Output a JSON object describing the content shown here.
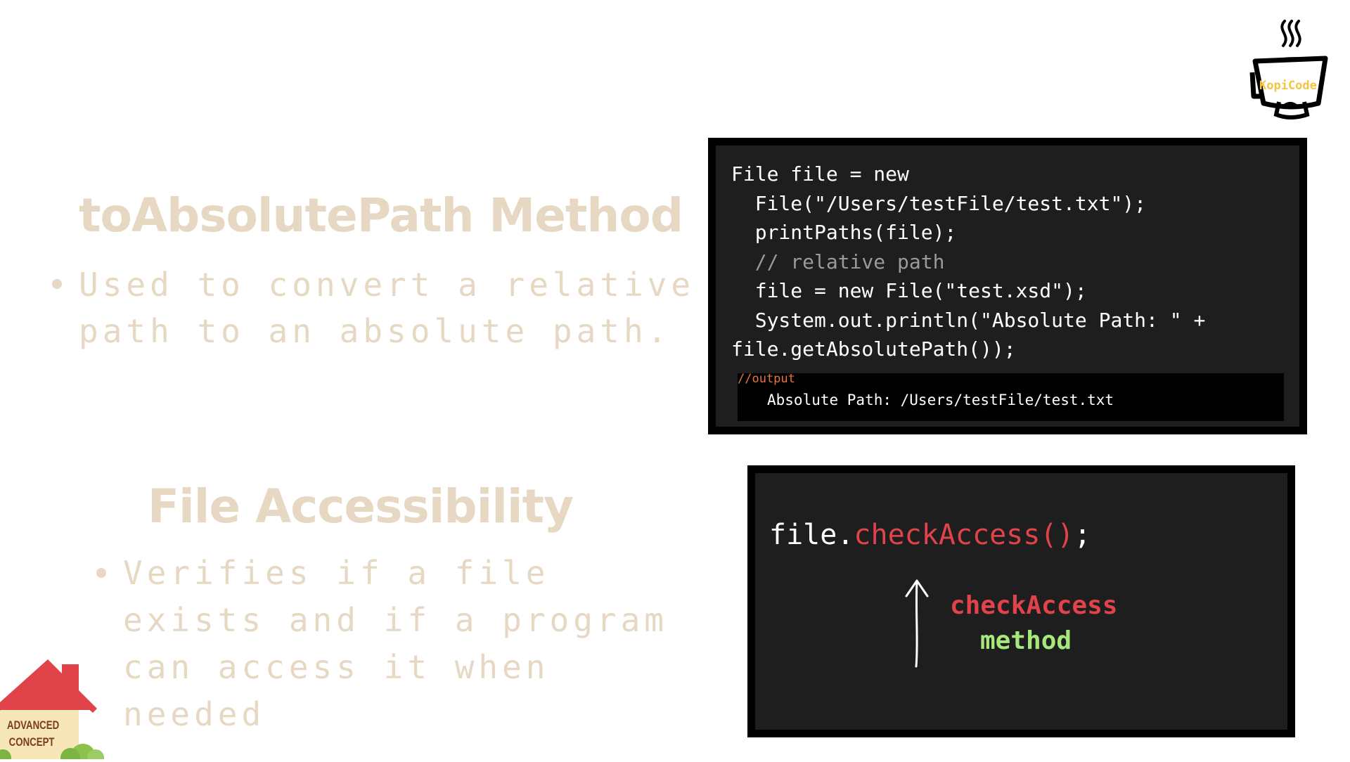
{
  "section1": {
    "title": "toAbsolutePath Method",
    "bullet": "Used to convert a relative path to an absolute path."
  },
  "section2": {
    "title": "File Accessibility",
    "bullet": "Verifies if a file exists and if a program can access it when needed"
  },
  "code_block_1": {
    "line1": "File file = new",
    "line2": "  File(\"/Users/testFile/test.txt\");",
    "line3": "  printPaths(file);",
    "line4": "  // relative path",
    "line5": "  file = new File(\"test.xsd\");",
    "line6": "  System.out.println(\"Absolute Path: \" +",
    "line7": "file.getAbsolutePath());",
    "output_label": "//output",
    "output_text": "Absolute Path: /Users/testFile/test.txt"
  },
  "code_block_2": {
    "call_prefix": "file.",
    "call_method": "checkAccess()",
    "call_suffix": ";",
    "annotation_line1": "checkAccess",
    "annotation_line2": "method"
  },
  "logo": {
    "text": "KopiCode"
  },
  "badge": {
    "line1": "ADVANCED",
    "line2": "CONCEPT"
  },
  "colors": {
    "heading": "#e6d8c3",
    "code_bg": "#1e1e1e",
    "method_red": "#e0434a",
    "method_green": "#a6e87c",
    "output_label": "#e8743b",
    "logo_yellow": "#f5c542"
  },
  "icons": {
    "logo": "coffee-cup-logo-icon",
    "badge": "house-icon",
    "arrow": "up-arrow-icon"
  }
}
